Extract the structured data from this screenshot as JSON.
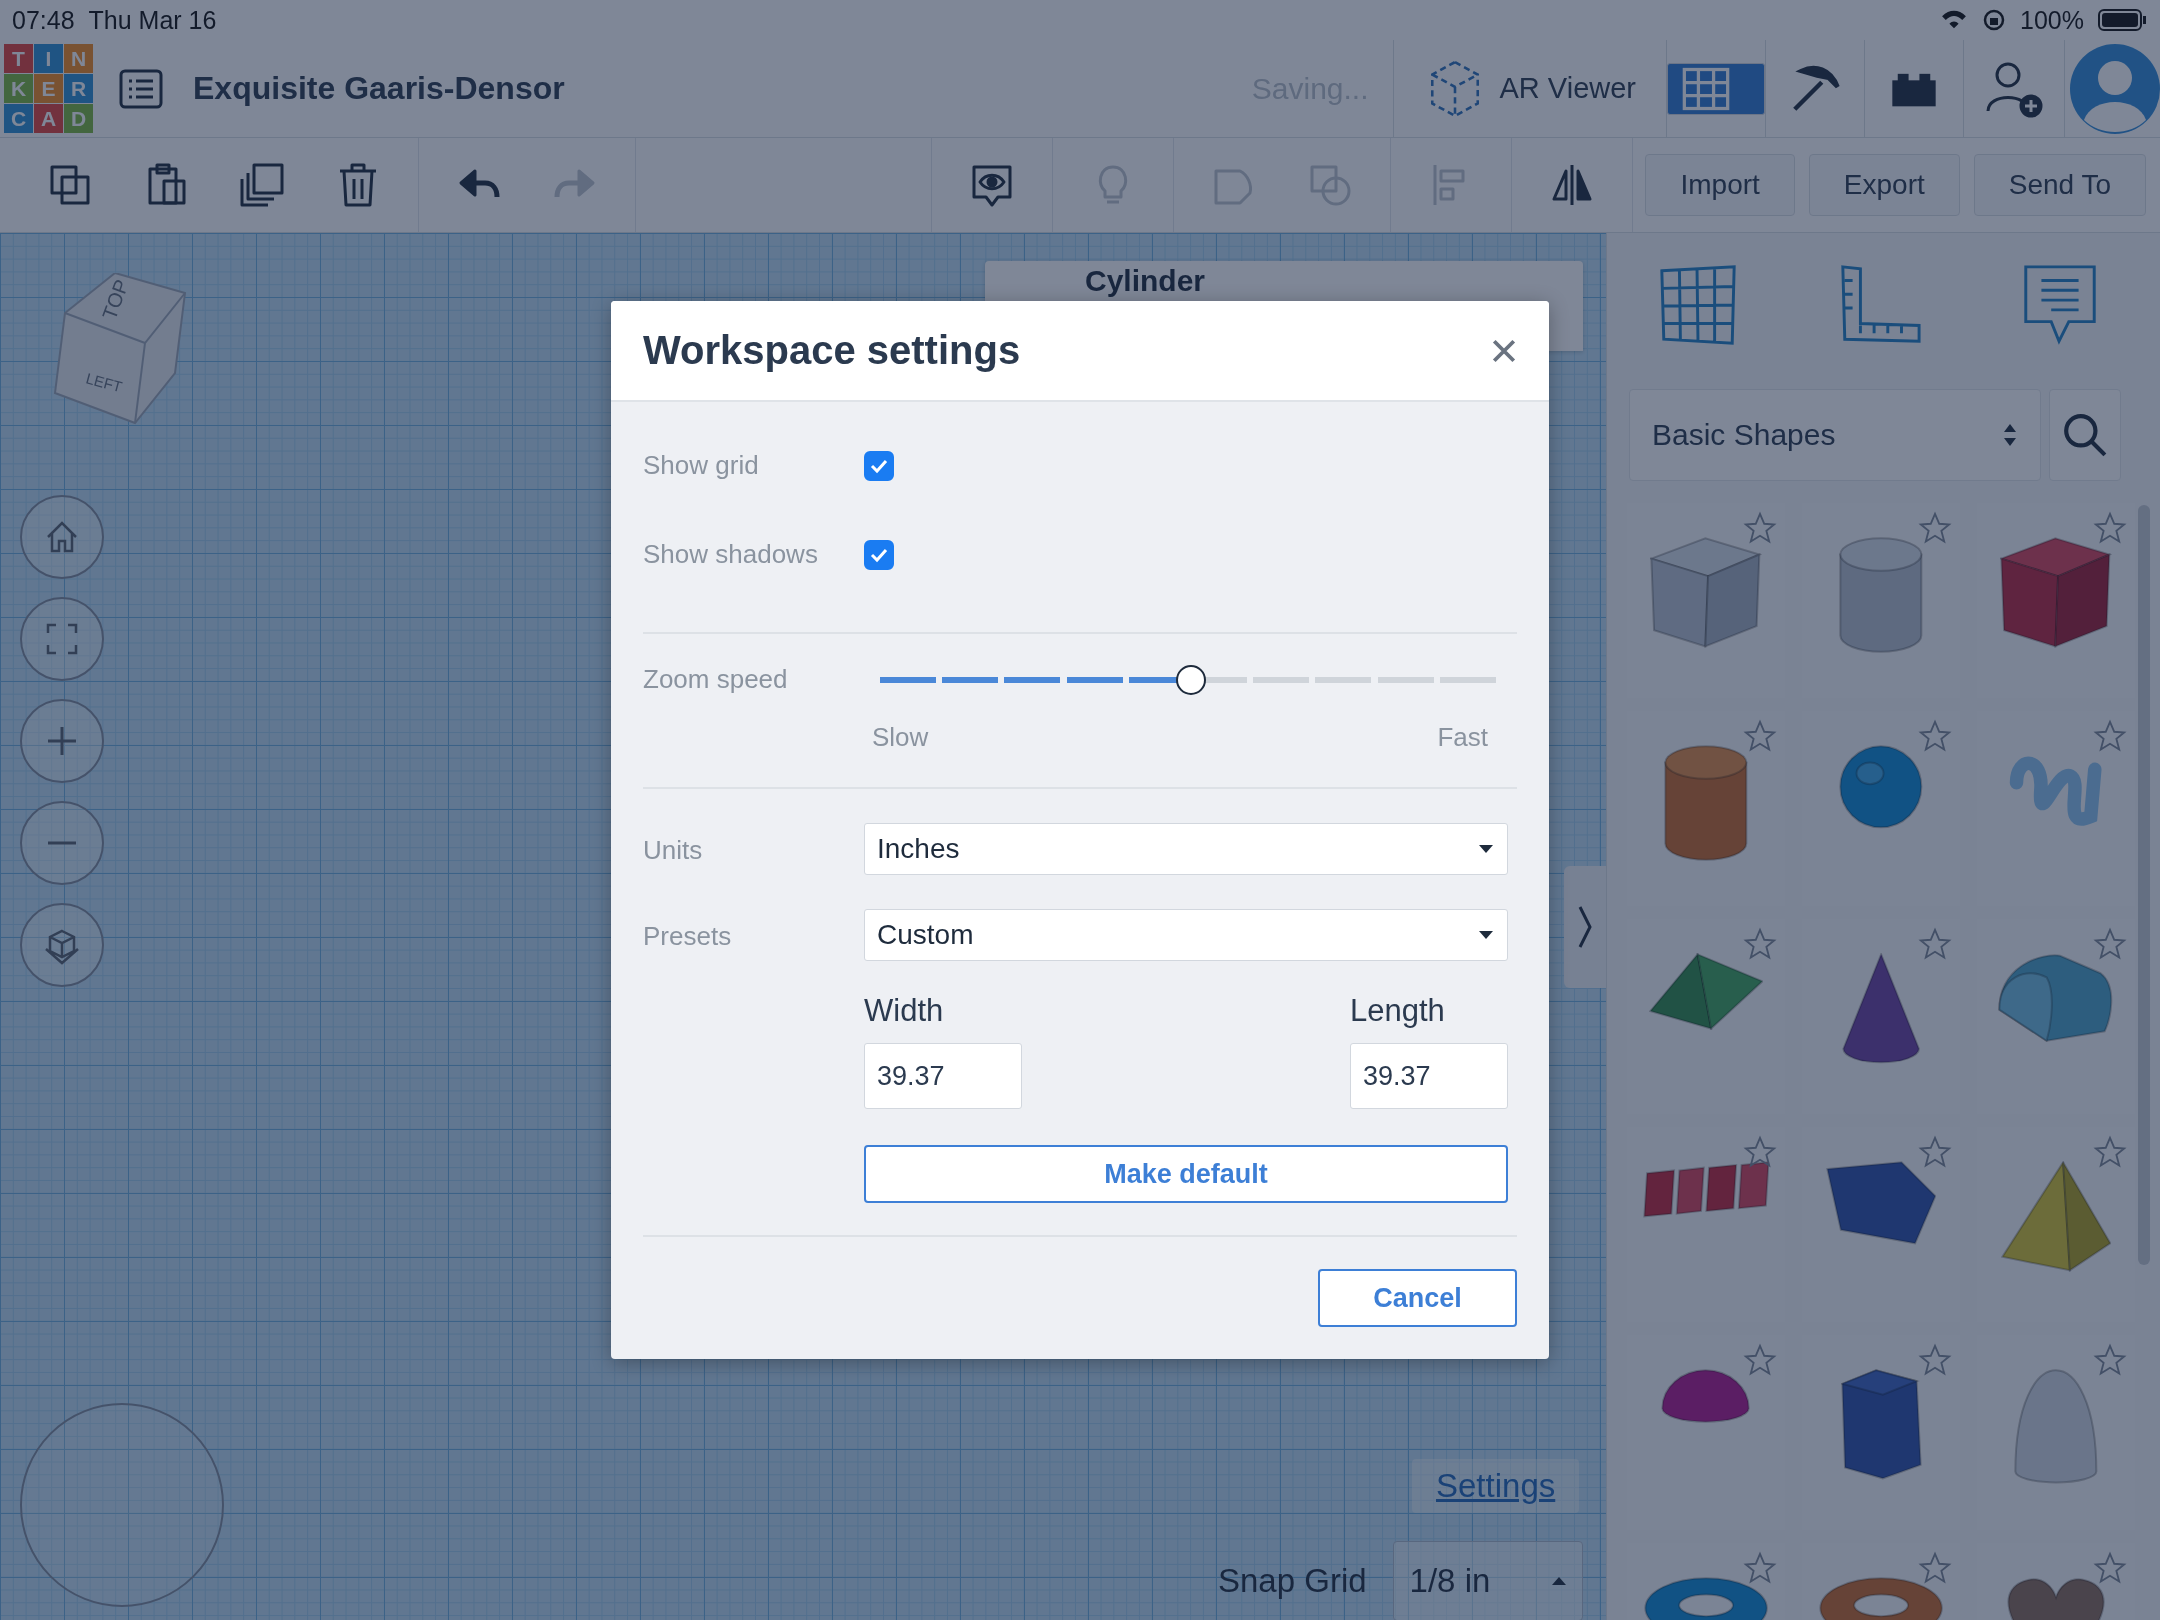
{
  "status_bar": {
    "time": "07:48",
    "date": "Thu Mar 16",
    "battery": "100%"
  },
  "logo": {
    "letters": [
      "T",
      "I",
      "N",
      "K",
      "E",
      "R",
      "C",
      "A",
      "D"
    ]
  },
  "header": {
    "title": "Exquisite Gaaris-Densor",
    "save_status": "Saving...",
    "ar_viewer": "AR Viewer",
    "views": [
      {
        "kind": "grid",
        "selected": true
      },
      {
        "kind": "pickaxe",
        "selected": false
      },
      {
        "kind": "bricks",
        "selected": false
      }
    ]
  },
  "toolbar": {
    "tools": [
      {
        "kind": "copy",
        "disabled": false
      },
      {
        "kind": "paste",
        "disabled": false
      },
      {
        "kind": "duplicate",
        "disabled": false
      },
      {
        "kind": "delete",
        "disabled": false
      },
      {
        "kind": "undo",
        "disabled": false
      },
      {
        "kind": "redo",
        "disabled": true
      }
    ],
    "right_tools": [
      {
        "kind": "notes",
        "disabled": false
      },
      {
        "kind": "light",
        "disabled": true
      },
      {
        "kind": "group",
        "disabled": true
      },
      {
        "kind": "ungroup",
        "disabled": true
      },
      {
        "kind": "align",
        "disabled": true
      },
      {
        "kind": "mirror",
        "disabled": false
      }
    ],
    "buttons": [
      "Import",
      "Export",
      "Send To"
    ]
  },
  "inspector": {
    "title": "Cylinder"
  },
  "workplane": {
    "view_cube": [
      "TOP",
      "LEFT"
    ],
    "settings_link": "Settings",
    "snap_grid": {
      "label": "Snap Grid",
      "value": "1/8 in"
    }
  },
  "library": {
    "category": "Basic Shapes",
    "shapes": [
      {
        "kind": "box-hole"
      },
      {
        "kind": "cylinder-hole"
      },
      {
        "kind": "box"
      },
      {
        "kind": "cylinder"
      },
      {
        "kind": "sphere"
      },
      {
        "kind": "scribble"
      },
      {
        "kind": "roof"
      },
      {
        "kind": "cone"
      },
      {
        "kind": "round-roof"
      },
      {
        "kind": "text"
      },
      {
        "kind": "polygon"
      },
      {
        "kind": "pyramid"
      },
      {
        "kind": "half-sphere"
      },
      {
        "kind": "hexagonal-prism"
      },
      {
        "kind": "paraboloid"
      },
      {
        "kind": "torus"
      },
      {
        "kind": "tube"
      },
      {
        "kind": "heart"
      }
    ]
  },
  "dialog": {
    "title": "Workspace settings",
    "checks": [
      {
        "label": "Show grid",
        "checked": true
      },
      {
        "label": "Show shadows",
        "checked": true
      }
    ],
    "zoom_speed": {
      "label": "Zoom speed",
      "level": 0.5,
      "min_label": "Slow",
      "max_label": "Fast"
    },
    "units": {
      "label": "Units",
      "value": "Inches"
    },
    "presets": {
      "label": "Presets",
      "value": "Custom"
    },
    "width": {
      "label": "Width",
      "value": "39.37"
    },
    "length": {
      "label": "Length",
      "value": "39.37"
    },
    "make_default": "Make default",
    "cancel": "Cancel"
  }
}
